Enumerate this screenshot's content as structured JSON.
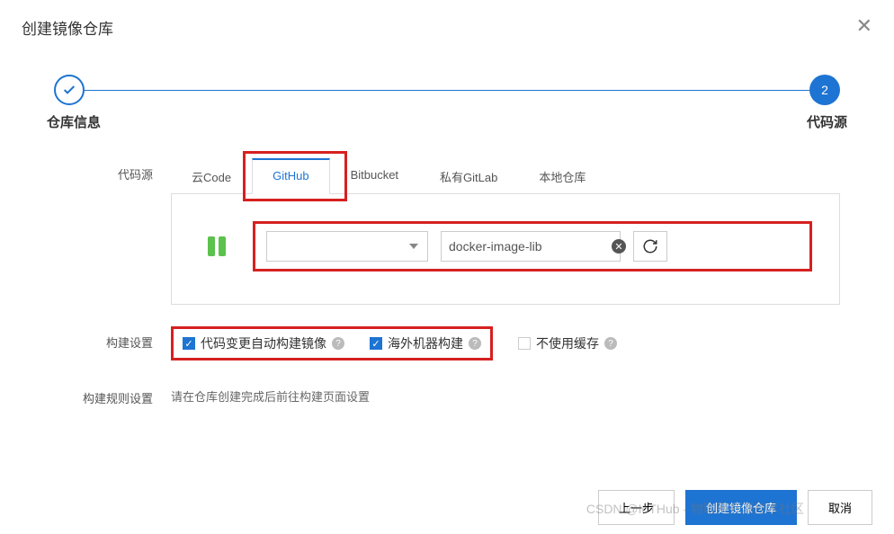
{
  "modal": {
    "title": "创建镜像仓库"
  },
  "stepper": {
    "step1_label": "仓库信息",
    "step2_label": "代码源",
    "step2_number": "2"
  },
  "form": {
    "source_label": "代码源",
    "tabs": {
      "cloud_code": "云Code",
      "github": "GitHub",
      "bitbucket": "Bitbucket",
      "private_gitlab": "私有GitLab",
      "local": "本地仓库"
    },
    "repo_input_value": "docker-image-lib",
    "build_settings_label": "构建设置",
    "checkboxes": {
      "auto_build": "代码变更自动构建镜像",
      "overseas": "海外机器构建",
      "no_cache": "不使用缓存"
    },
    "build_rules_label": "构建规则设置",
    "build_rules_text": "请在仓库创建完成后前往构建页面设置"
  },
  "footer": {
    "prev": "上一步",
    "create": "创建镜像仓库",
    "cancel": "取消"
  },
  "watermark": "CSDN @IoTHub - 物联网开源技术社区"
}
